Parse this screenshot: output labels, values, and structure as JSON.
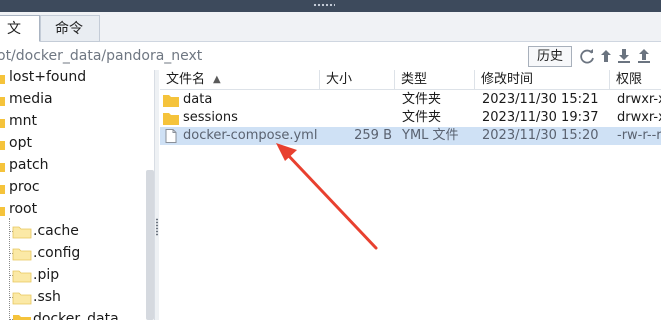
{
  "tabs": [
    {
      "label": "文件",
      "active": true
    },
    {
      "label": "命令",
      "active": false
    }
  ],
  "path": {
    "value": "ot/docker_data/pandora_next"
  },
  "toolbar": {
    "history_label": "历史"
  },
  "tree": {
    "items": [
      {
        "label": "lost+found",
        "level": 0
      },
      {
        "label": "media",
        "level": 0
      },
      {
        "label": "mnt",
        "level": 0
      },
      {
        "label": "opt",
        "level": 0
      },
      {
        "label": "patch",
        "level": 0
      },
      {
        "label": "proc",
        "level": 0
      },
      {
        "label": "root",
        "level": 0
      },
      {
        "label": ".cache",
        "level": 1
      },
      {
        "label": ".config",
        "level": 1
      },
      {
        "label": ".pip",
        "level": 1
      },
      {
        "label": ".ssh",
        "level": 1
      },
      {
        "label": "docker_data",
        "level": 1
      }
    ]
  },
  "columns": {
    "name": "文件名",
    "size": "大小",
    "type": "类型",
    "mtime": "修改时间",
    "perm": "权限"
  },
  "files": [
    {
      "name": "data",
      "size": "",
      "type": "文件夹",
      "mtime": "2023/11/30 15:21",
      "perm": "drwxr-xr-x",
      "icon": "folder-icon",
      "selected": false
    },
    {
      "name": "sessions",
      "size": "",
      "type": "文件夹",
      "mtime": "2023/11/30 19:37",
      "perm": "drwxr-xr-x",
      "icon": "folder-icon",
      "selected": false
    },
    {
      "name": "docker-compose.yml",
      "size": "259 B",
      "type": "YML 文件",
      "mtime": "2023/11/30 15:20",
      "perm": "-rw-r--r--",
      "icon": "file-icon",
      "selected": true
    }
  ],
  "colors": {
    "folder": "#f5c33b",
    "selection": "#cfe1f5",
    "annotation_arrow": "#e8402f"
  }
}
